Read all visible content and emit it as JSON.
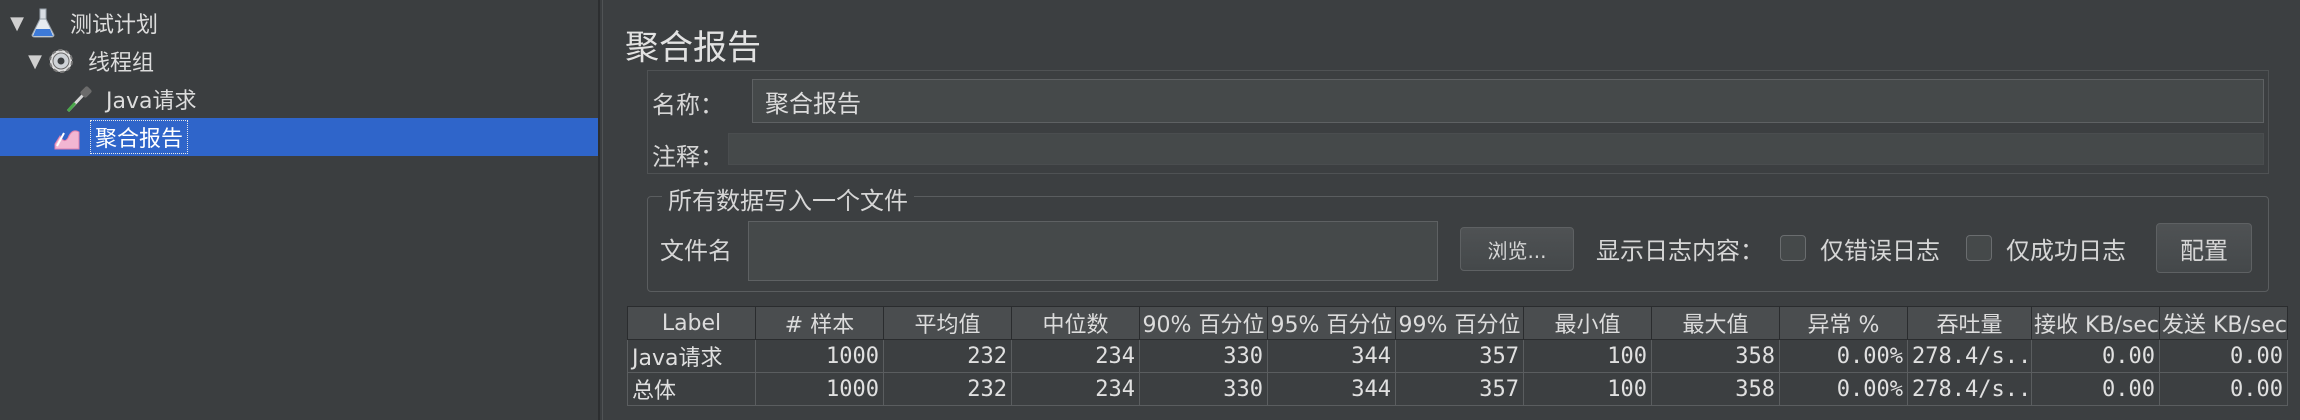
{
  "tree": {
    "items": [
      {
        "label": "测试计划",
        "icon": "flask-icon",
        "expanded": true
      },
      {
        "label": "线程组",
        "icon": "gear-icon",
        "expanded": true
      },
      {
        "label": "Java请求",
        "icon": "dropper-icon"
      },
      {
        "label": "聚合报告",
        "icon": "report-icon",
        "selected": true
      }
    ]
  },
  "panel": {
    "title": "聚合报告",
    "name_label": "名称：",
    "name_value": "聚合报告",
    "comment_label": "注释：",
    "comment_value": "",
    "file_group": {
      "title": "所有数据写入一个文件",
      "filename_label": "文件名",
      "filename_value": "",
      "browse_button": "浏览...",
      "log_content_label": "显示日志内容：",
      "errors_only_label": "仅错误日志",
      "success_only_label": "仅成功日志",
      "configure_button": "配置"
    }
  },
  "table": {
    "headers": [
      "Label",
      "# 样本",
      "平均值",
      "中位数",
      "90% 百分位",
      "95% 百分位",
      "99% 百分位",
      "最小值",
      "最大值",
      "异常 %",
      "吞吐量",
      "接收 KB/sec",
      "发送 KB/sec"
    ],
    "rows": [
      [
        "Java请求",
        "1000",
        "232",
        "234",
        "330",
        "344",
        "357",
        "100",
        "358",
        "0.00%",
        "278.4/s...",
        "0.00",
        "0.00"
      ],
      [
        "总体",
        "1000",
        "232",
        "234",
        "330",
        "344",
        "357",
        "100",
        "358",
        "0.00%",
        "278.4/s...",
        "0.00",
        "0.00"
      ]
    ]
  },
  "colors": {
    "selection": "#2f65ca",
    "background": "#3c3f41"
  }
}
